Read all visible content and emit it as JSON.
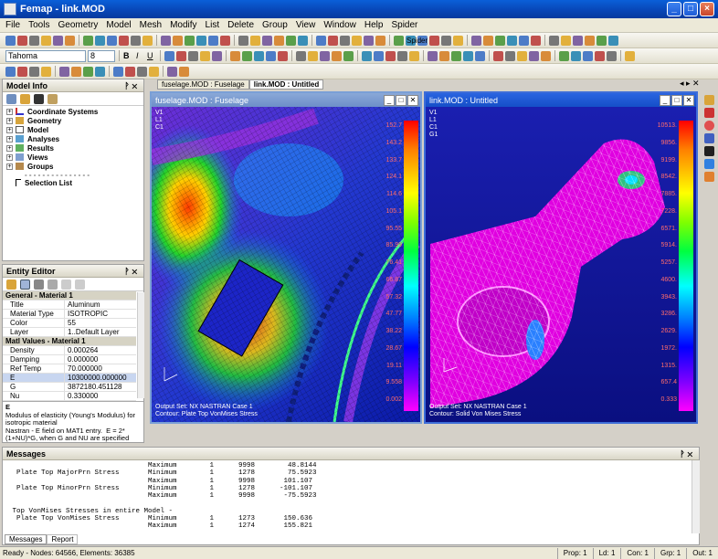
{
  "window": {
    "title": "Femap - link.MOD"
  },
  "menu": [
    "File",
    "Tools",
    "Geometry",
    "Model",
    "Mesh",
    "Modify",
    "List",
    "Delete",
    "Group",
    "View",
    "Window",
    "Help",
    "Spider"
  ],
  "toolbar": {
    "spider_label": "Spider",
    "font_name": "Tahoma",
    "font_size": "8"
  },
  "model_info": {
    "title": "Model Info",
    "tree": [
      "Coordinate Systems",
      "Geometry",
      "Model",
      "Analyses",
      "Results",
      "Views",
      "Groups",
      "Selection List"
    ]
  },
  "entity_editor": {
    "title": "Entity Editor",
    "general_header": "General - Material 1",
    "general": [
      {
        "k": "Title",
        "v": "Aluminum"
      },
      {
        "k": "Material Type",
        "v": "ISOTROPIC"
      },
      {
        "k": "Color",
        "v": "55"
      },
      {
        "k": "Layer",
        "v": "1..Default Layer"
      }
    ],
    "values_header": "Matl Values - Material 1",
    "values": [
      {
        "k": "Density",
        "v": "0.000264"
      },
      {
        "k": "Damping",
        "v": "0.000000"
      },
      {
        "k": "Ref Temp",
        "v": "70.000000"
      },
      {
        "k": "E",
        "v": "10300000.000000"
      },
      {
        "k": "G",
        "v": "3872180.451128"
      },
      {
        "k": "Nu",
        "v": "0.330000"
      }
    ],
    "desc_title": "E",
    "desc": "Modulus of elasticity (Young's Modulus) for isotropic material\nNastran - E field on MAT1 entry.  E = 2*(1+NU)*G, when G and NU are specified"
  },
  "tabs": [
    "fuselage.MOD : Fuselage",
    "link.MOD : Untitled"
  ],
  "view1": {
    "title": "fuselage.MOD : Fuselage",
    "labels": [
      "V1",
      "L1",
      "C1"
    ],
    "legend": [
      "152.7",
      "143.2",
      "133.7",
      "124.1",
      "114.6",
      "105.1",
      "95.55",
      "85.99",
      "76.41",
      "66.87",
      "57.32",
      "47.77",
      "38.22",
      "28.67",
      "19.11",
      "9.558",
      "0.002"
    ],
    "output_set": "Output Set: NX NASTRAN Case 1",
    "contour": "Contour: Plate Top VonMises Stress"
  },
  "view2": {
    "title": "link.MOD : Untitled",
    "labels": [
      "V1",
      "L1",
      "C1",
      "G1"
    ],
    "legend": [
      "10513.",
      "9856.",
      "9199.",
      "8542.",
      "7885.",
      "7228.",
      "6571.",
      "5914.",
      "5257.",
      "4600.",
      "3943.",
      "3286.",
      "2629.",
      "1972.",
      "1315.",
      "657.4",
      "0.333"
    ],
    "output_set": "Output Set: NX NASTRAN Case 1",
    "contour": "Contour: Solid Von Mises Stress"
  },
  "messages": {
    "title": "Messages",
    "lines": [
      "                                  Maximum        1      9998        48.8144",
      "  Plate Top MajorPrn Stress       Minimum        1      1278        75.5923",
      "                                  Maximum        1      9998       101.107",
      "  Plate Top MinorPrn Stress       Minimum        1      1278      -101.107",
      "                                  Maximum        1      9998       -75.5923",
      "",
      " Top VonMises Stresses in entire Model -",
      "  Plate Top VonMises Stress       Minimum        1      1273       150.636",
      "                                  Maximum        1      1274       155.821"
    ],
    "tab_messages": "Messages",
    "tab_report": "Report"
  },
  "status": {
    "text": "Ready - Nodes: 64566,  Elements: 36385",
    "prop": "Prop: 1",
    "ld": "Ld: 1",
    "con": "Con: 1",
    "grp": "Grp: 1",
    "out": "Out: 1"
  }
}
